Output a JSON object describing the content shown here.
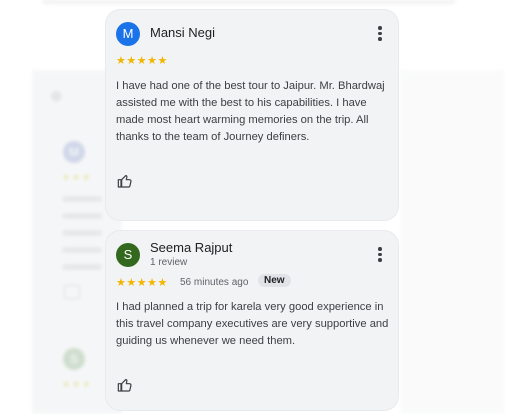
{
  "background": {
    "avatar_1": "M",
    "avatar_2": "S",
    "stars": "★★★"
  },
  "reviews": [
    {
      "avatar_letter": "M",
      "avatar_color": "#1a73e8",
      "name": "Mansi Negi",
      "subtitle": "",
      "rating": 5,
      "stars": "★★★★★",
      "time": "",
      "badge": "",
      "text": "I have had one of the best tour to Jaipur. Mr. Bhardwaj assisted me with the best to his capabilities. I have made most heart warming memories on the trip. All thanks to the team of Journey definers.",
      "like_icon": "thumbs-up-icon",
      "menu_icon": "more-vert-icon"
    },
    {
      "avatar_letter": "S",
      "avatar_color": "#33691e",
      "name": "Seema Rajput",
      "subtitle": "1 review",
      "rating": 5,
      "stars": "★★★★★",
      "time": "56 minutes ago",
      "badge": "New",
      "text": "I had planned a trip for karela very good experience in this travel company executives are very supportive and guiding us whenever we need them.",
      "like_icon": "thumbs-up-icon",
      "menu_icon": "more-vert-icon"
    }
  ],
  "colors": {
    "star": "#f2b600",
    "card_bg": "#f1f3f4",
    "text": "#3c4043"
  }
}
